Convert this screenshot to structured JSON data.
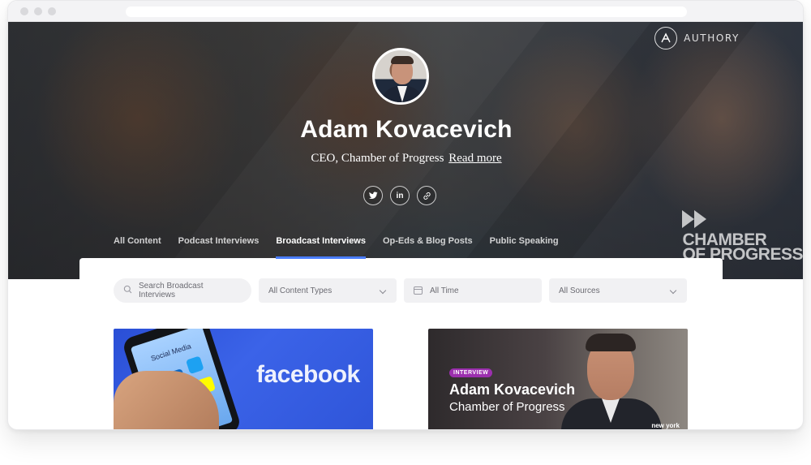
{
  "brand": {
    "name": "AUTHORY"
  },
  "profile": {
    "name": "Adam Kovacevich",
    "subtitle": "CEO, Chamber of Progress",
    "read_more": "Read more",
    "org_logo_lines": [
      "CHAMBER",
      "OF PROGRESS"
    ]
  },
  "socials": [
    {
      "icon": "twitter-icon",
      "glyph": "🐦"
    },
    {
      "icon": "linkedin-icon",
      "glyph": "in"
    },
    {
      "icon": "link-icon",
      "glyph": "🔗"
    }
  ],
  "tabs": [
    {
      "label": "All Content",
      "active": false
    },
    {
      "label": "Podcast Interviews",
      "active": false
    },
    {
      "label": "Broadcast Interviews",
      "active": true
    },
    {
      "label": "Op-Eds & Blog Posts",
      "active": false
    },
    {
      "label": "Public Speaking",
      "active": false
    }
  ],
  "filters": {
    "search_placeholder": "Search Broadcast Interviews",
    "content_types": "All Content Types",
    "time": "All Time",
    "sources": "All Sources"
  },
  "cards": [
    {
      "thumbnail_text": "facebook",
      "screen_text": "Social Media"
    },
    {
      "badge": "INTERVIEW",
      "title": "Adam Kovacevich",
      "subtitle": "Chamber of Progress",
      "source_mark": "new york"
    }
  ],
  "colors": {
    "accent": "#4a7dff",
    "badge": "#9b2fae",
    "facebook_blue": "#3b63e8"
  }
}
